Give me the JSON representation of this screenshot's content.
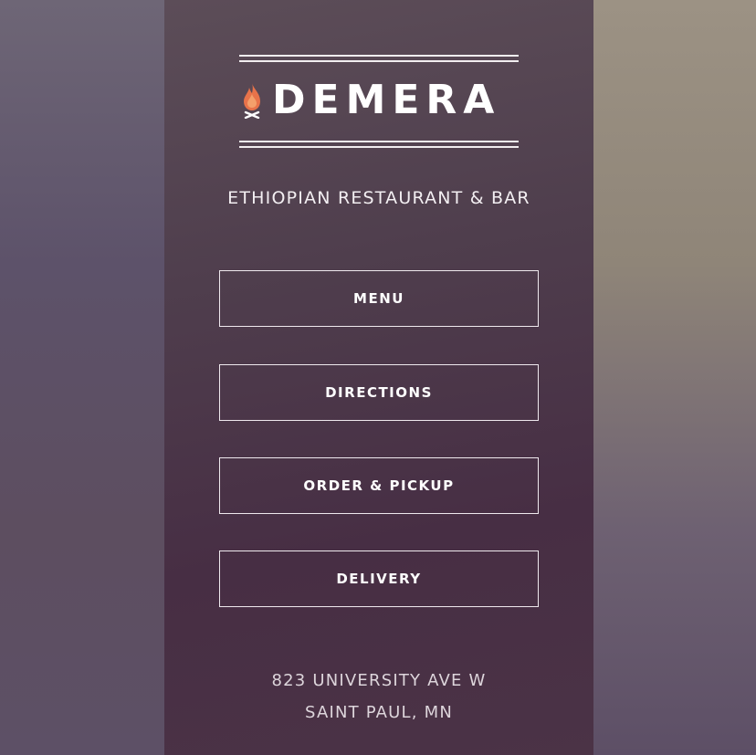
{
  "brand": {
    "name": "DEMERA",
    "tagline": "ETHIOPIAN RESTAURANT & BAR",
    "flame_colors": [
      "#e8734a",
      "#f4a06b",
      "#ffffff"
    ]
  },
  "nav": {
    "items": [
      {
        "label": "MENU"
      },
      {
        "label": "DIRECTIONS"
      },
      {
        "label": "ORDER & PICKUP"
      },
      {
        "label": "DELIVERY"
      }
    ]
  },
  "address": {
    "street": "823 UNIVERSITY AVE W",
    "city": "SAINT PAUL, MN"
  },
  "theme": {
    "panel_color": "#4f3e4d",
    "text_color": "#ffffff"
  }
}
